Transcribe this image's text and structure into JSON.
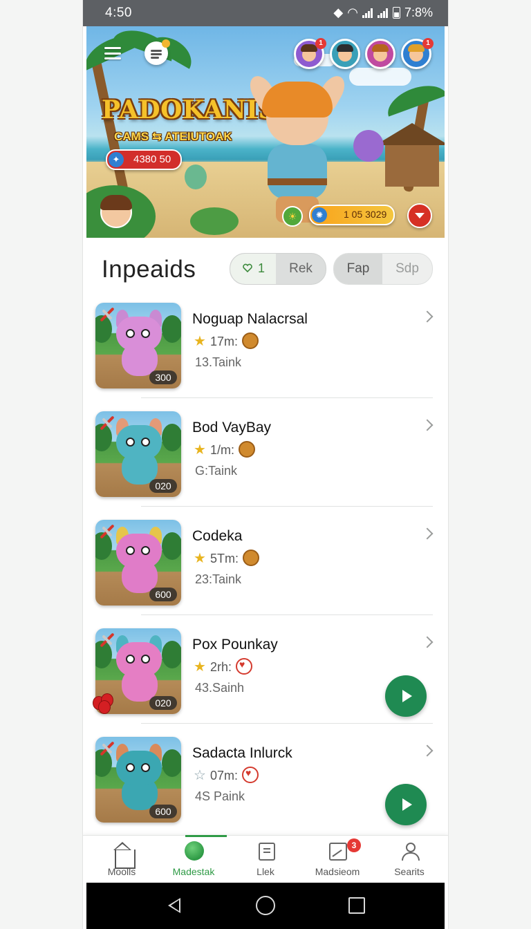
{
  "status_bar": {
    "time": "4:50",
    "battery": "7:8%"
  },
  "hero": {
    "title": "PADOKANISII",
    "subtitle": "CAMS ⇆ ATEIUTOAK",
    "coins": "4380 50",
    "energy": "1 05 3029",
    "energy_icon": "☀",
    "avatars": [
      {
        "name": "avatar-1",
        "badge": "1",
        "hair": "#5a3418",
        "ring": "#8e5bd0"
      },
      {
        "name": "avatar-2",
        "badge": "",
        "hair": "#2d2d2d",
        "ring": "#3aa0b8"
      },
      {
        "name": "avatar-3",
        "badge": "",
        "hair": "#b5651d",
        "ring": "#c04aa0"
      },
      {
        "name": "avatar-4",
        "badge": "1",
        "hair": "#e0a02a",
        "ring": "#2f7fd1"
      }
    ]
  },
  "section": {
    "title": "Inpeaids",
    "likes_count": "1",
    "tab_rek": "Rek",
    "tab_fap": "Fap",
    "tab_sdp": "Sdp"
  },
  "items": [
    {
      "title": "Noguap Nalacrsal",
      "meta": "17m:",
      "count": "13.Taink",
      "badge": "300",
      "color": "#d98ed8",
      "ear": "#c98ad2",
      "star": "filled",
      "currency": "coin",
      "play": false,
      "berries": false
    },
    {
      "title": "Bod VayBay",
      "meta": "1/m:",
      "count": "G:Taink",
      "badge": "020",
      "color": "#4fb4c2",
      "ear": "#e39a78",
      "star": "filled",
      "currency": "coin",
      "play": false,
      "berries": false
    },
    {
      "title": "Codeka",
      "meta": "5Tm:",
      "count": "23:Taink",
      "badge": "600",
      "color": "#e07cc8",
      "ear": "#e6c54a",
      "star": "filled",
      "currency": "coin",
      "play": false,
      "berries": false
    },
    {
      "title": "Pox Pounkay",
      "meta": "2rh:",
      "count": "43.Sainh",
      "badge": "020",
      "color": "#e57ec4",
      "ear": "#4fb4c2",
      "star": "filled",
      "currency": "heart",
      "play": true,
      "berries": true
    },
    {
      "title": "Sadacta Inlurck",
      "meta": "07m:",
      "count": "4S Paink",
      "badge": "600",
      "color": "#3ba7b2",
      "ear": "#d98a5a",
      "star": "outline",
      "currency": "heart",
      "play": true,
      "berries": false
    }
  ],
  "nav": {
    "items": [
      {
        "label": "Moolls",
        "icon": "home-icon"
      },
      {
        "label": "Madestak",
        "icon": "globe-icon"
      },
      {
        "label": "Llek",
        "icon": "document-icon"
      },
      {
        "label": "Madsieom",
        "icon": "chart-icon",
        "badge": "3"
      },
      {
        "label": "Searits",
        "icon": "profile-icon"
      }
    ],
    "active_index": 1
  },
  "colors": {
    "accent": "#2e9a45",
    "play": "#1f8a52",
    "badge": "#e53935",
    "status_bar": "#5d6064"
  }
}
